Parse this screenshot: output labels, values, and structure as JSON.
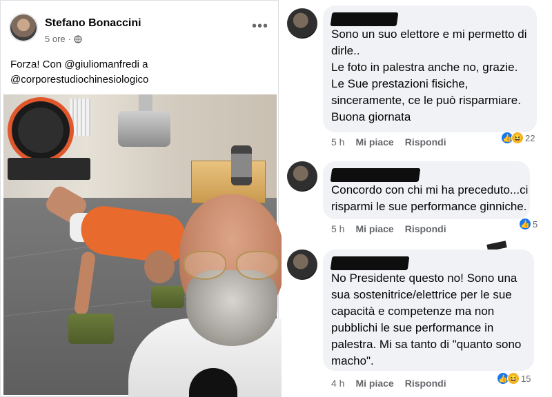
{
  "post": {
    "author": "Stefano Bonaccini",
    "time": "5 ore",
    "privacy_icon": "globe-icon",
    "more_icon": "more-horizontal-icon",
    "text_lines": [
      "Forza! Con @giuliomanfredi a",
      "@corporestudiochinesiologico"
    ]
  },
  "comments": [
    {
      "text_lines": [
        "Sono un suo elettore e mi permetto di",
        "dirle..",
        "Le foto in palestra anche no, grazie.",
        "Le Sue prestazioni fisiche,",
        "sinceramente, ce le può risparmiare.",
        "Buona giornata"
      ],
      "time": "5 h",
      "like_label": "Mi piace",
      "reply_label": "Rispondi",
      "reaction_count": "22",
      "reactions": [
        "like",
        "haha"
      ]
    },
    {
      "text_lines": [
        "Concordo con chi mi ha preceduto...ci",
        "risparmi le sue performance ginniche."
      ],
      "time": "5 h",
      "like_label": "Mi piace",
      "reply_label": "Rispondi",
      "reaction_count": "5",
      "reactions": [
        "like"
      ]
    },
    {
      "text_lines": [
        "No Presidente questo no! Sono una",
        "sua sostenitrice/elettrice per le sue",
        "capacità e competenze ma non",
        "pubblichi le sue performance in",
        "palestra. Mi sa tanto di \"quanto sono",
        "macho\"."
      ],
      "time": "4 h",
      "like_label": "Mi piace",
      "reply_label": "Rispondi",
      "reaction_count": "15",
      "reactions": [
        "like",
        "haha"
      ]
    }
  ],
  "colors": {
    "facebook_blue": "#1877f2",
    "bubble_bg": "#f0f2f5",
    "secondary_text": "#65676b",
    "shirt_orange": "#e86a2c"
  }
}
